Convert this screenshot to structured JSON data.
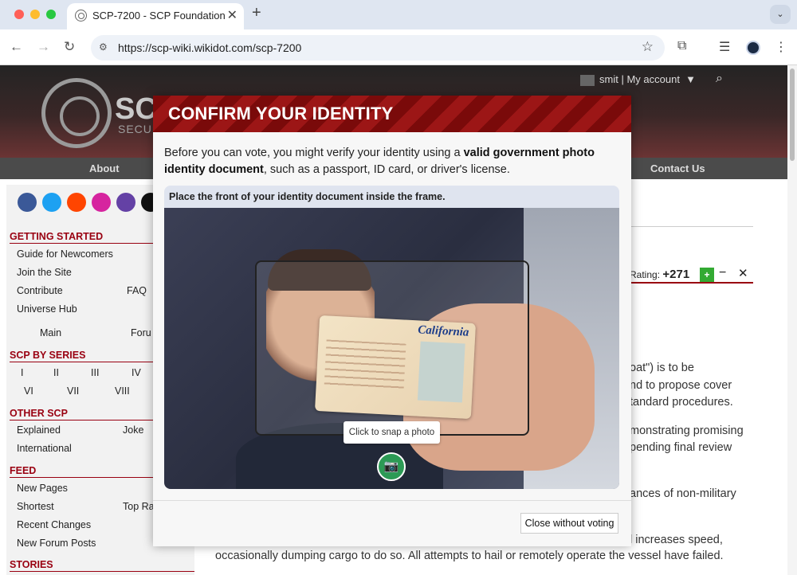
{
  "browser": {
    "tab_title": "SCP-7200 - SCP Foundation",
    "url": "https://scp-wiki.wikidot.com/scp-7200"
  },
  "site": {
    "logo_text": "SC",
    "logo_sub": "SECU",
    "user": "smit",
    "my_account": "My account",
    "nav": {
      "about": "About",
      "contact": "Contact Us"
    }
  },
  "sidebar": {
    "sections": [
      {
        "title": "GETTING STARTED"
      },
      {
        "title": "SCP BY SERIES"
      },
      {
        "title": "OTHER SCP"
      },
      {
        "title": "FEED"
      },
      {
        "title": "STORIES"
      }
    ],
    "items": {
      "guide": "Guide for Newcomers",
      "join": "Join the Site",
      "contribute": "Contribute",
      "faq": "FAQ",
      "universe": "Universe Hub",
      "main": "Main",
      "forum": "Foru",
      "s1": "I",
      "s2": "II",
      "s3": "III",
      "s4": "IV",
      "s6": "VI",
      "s7": "VII",
      "s8": "VIII",
      "explained": "Explained",
      "joke": "Joke",
      "international": "International",
      "new_pages": "New Pages",
      "shortest": "Shortest",
      "top_rated": "Top Ra",
      "recent": "Recent Changes",
      "forum_posts": "New Forum Posts"
    }
  },
  "content": {
    "rating_label": "Rating:",
    "rating_value": "+271",
    "lines": [
      "oat\") is to be",
      "nd to propose cover",
      "tandard procedures.",
      "monstrating promising",
      "pending final review",
      "ances of non-military",
      "l increases speed,",
      "occasionally dumping cargo to do so. All attempts to hail or remotely operate the vessel have failed."
    ]
  },
  "modal": {
    "title": "CONFIRM YOUR IDENTITY",
    "intro_1": "Before you can vote, you might verify your identity using a ",
    "intro_bold": "valid government photo identity document",
    "intro_2": ", such as a passport, ID card, or driver's license.",
    "camera_label": "Place the front of your identity document inside the frame.",
    "id_state": "California",
    "snap_tooltip": "Click to snap a photo",
    "close_button": "Close without voting"
  }
}
